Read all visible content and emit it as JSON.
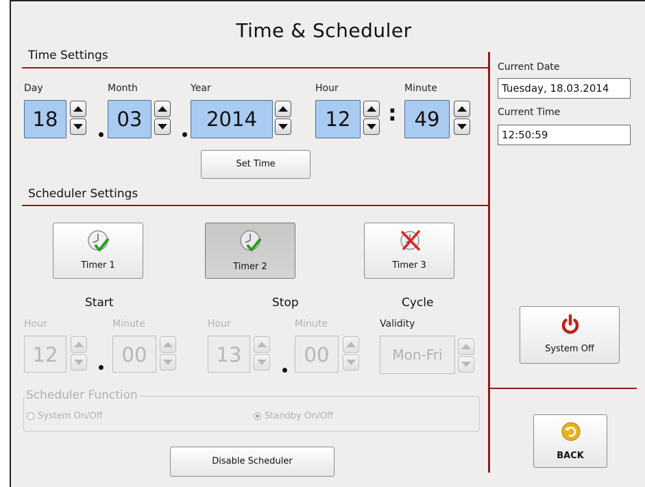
{
  "title": "Time & Scheduler",
  "time_settings": {
    "heading": "Time Settings",
    "day": {
      "label": "Day",
      "value": "18"
    },
    "month": {
      "label": "Month",
      "value": "03"
    },
    "year": {
      "label": "Year",
      "value": "2014"
    },
    "hour": {
      "label": "Hour",
      "value": "12"
    },
    "minute": {
      "label": "Minute",
      "value": "49"
    },
    "set_button": "Set Time"
  },
  "current": {
    "date_label": "Current Date",
    "date_value": "Tuesday, 18.03.2014",
    "time_label": "Current Time",
    "time_value": "12:50:59"
  },
  "scheduler": {
    "heading": "Scheduler Settings",
    "timers": [
      {
        "label": "Timer 1",
        "icon": "clock-check-icon",
        "state": "enabled"
      },
      {
        "label": "Timer 2",
        "icon": "clock-check-icon",
        "state": "selected"
      },
      {
        "label": "Timer 3",
        "icon": "clock-disabled-icon",
        "state": "disabled"
      }
    ],
    "start": {
      "heading": "Start",
      "hour_label": "Hour",
      "hour_value": "12",
      "minute_label": "Minute",
      "minute_value": "00"
    },
    "stop": {
      "heading": "Stop",
      "hour_label": "Hour",
      "hour_value": "13",
      "minute_label": "Minute",
      "minute_value": "00"
    },
    "cycle": {
      "heading": "Cycle",
      "validity_label": "Validity",
      "validity_value": "Mon-Fri"
    },
    "function_group": {
      "title": "Scheduler Function",
      "options": [
        {
          "label": "System On/Off",
          "selected": false
        },
        {
          "label": "Standby On/Off",
          "selected": true
        }
      ]
    },
    "disable_button": "Disable Scheduler"
  },
  "side": {
    "system_off": "System Off",
    "back": "BACK"
  },
  "colors": {
    "accent_rule": "#8e1a1a",
    "spin_active": "#a9cbf2",
    "power_red": "#c0201a",
    "back_yellow": "#e8b21c",
    "check_green": "#2c9b22",
    "cross_red": "#d6261c"
  }
}
